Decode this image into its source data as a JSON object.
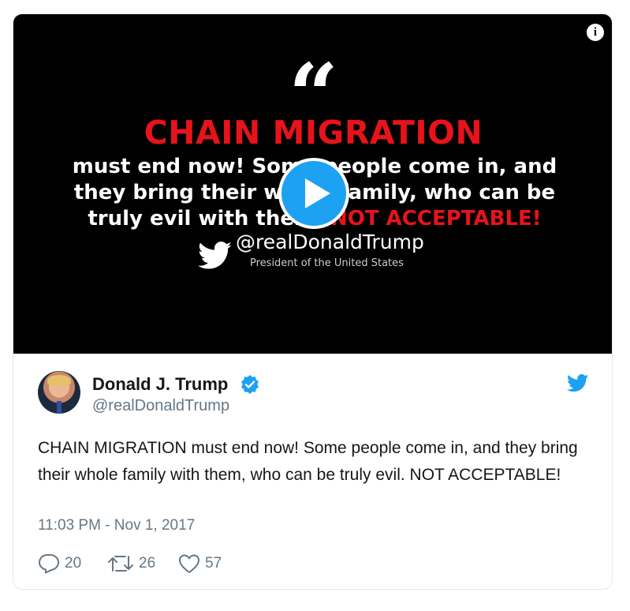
{
  "media": {
    "info_icon": "info-icon",
    "quote_mark": "“",
    "headline": "CHAIN MIGRATION",
    "body_part1": "must end now! Some people come in, and they bring their whole family, who can be truly evil with them. ",
    "body_part2": "NOT ACCEPTABLE!",
    "signature_handle": "@realDonaldTrump",
    "signature_title": "President of the United States",
    "play_icon": "play-icon"
  },
  "tweet": {
    "name": "Donald J. Trump",
    "handle": "@realDonaldTrump",
    "text": "CHAIN MIGRATION must end now! Some people come in, and they bring their whole family with them, who can be truly evil. NOT ACCEPTABLE!",
    "timestamp": "11:03 PM - Nov 1, 2017",
    "replies": "20",
    "retweets": "26",
    "likes": "57"
  },
  "colors": {
    "accent": "#1da1f2",
    "red": "#e8131a",
    "muted": "#657786"
  }
}
